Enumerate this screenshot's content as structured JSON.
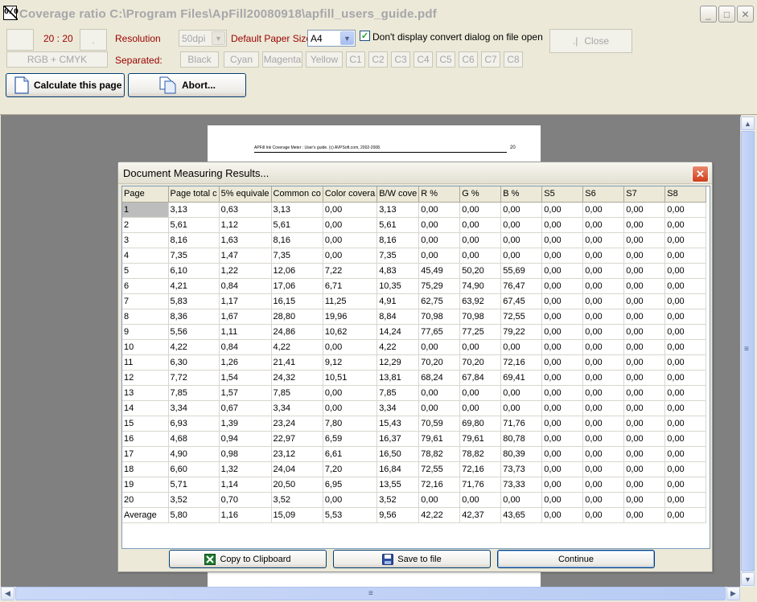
{
  "window": {
    "icon_text": "0/0",
    "title": "Coverage ratio C:\\Program Files\\ApFill20080918\\apfill_users_guide.pdf",
    "controls": {
      "minimize": "_",
      "maximize": "□",
      "close": "✕"
    }
  },
  "toolbar": {
    "blank1": "",
    "page_range": "20 : 20",
    "blank2": ".",
    "resolution_label": "Resolution",
    "resolution_value": "50dpi",
    "paper_size_label": "Default Paper Size",
    "paper_size_value": "A4",
    "dont_display_label": "Don't display convert dialog on file open",
    "dont_display_checked": true,
    "close_label": "Close",
    "rgb_cmyk_label": "RGB + CMYK",
    "separated_label": "Separated:",
    "separations": [
      "Black",
      "Cyan",
      "Magenta",
      "Yellow",
      "C1",
      "C2",
      "C3",
      "C4",
      "C5",
      "C6",
      "C7",
      "C8"
    ],
    "calculate_label": "Calculate this page",
    "abort_label": "Abort..."
  },
  "page_preview": {
    "header_text": "APFill Ink Coverage Meter : User's guide. (c) AVPSoft.com, 2002-2008.",
    "page_number": "20"
  },
  "dialog": {
    "title": "Document Measuring Results...",
    "close": "✕",
    "columns": [
      "Page",
      "Page total c",
      "5% equivale",
      "Common co",
      "Color covera",
      "B/W cove",
      "R %",
      "G %",
      "B %",
      "S5",
      "S6",
      "S7",
      "S8"
    ],
    "rows": [
      [
        "1",
        "3,13",
        "0,63",
        "3,13",
        "0,00",
        "3,13",
        "0,00",
        "0,00",
        "0,00",
        "0,00",
        "0,00",
        "0,00",
        "0,00"
      ],
      [
        "2",
        "5,61",
        "1,12",
        "5,61",
        "0,00",
        "5,61",
        "0,00",
        "0,00",
        "0,00",
        "0,00",
        "0,00",
        "0,00",
        "0,00"
      ],
      [
        "3",
        "8,16",
        "1,63",
        "8,16",
        "0,00",
        "8,16",
        "0,00",
        "0,00",
        "0,00",
        "0,00",
        "0,00",
        "0,00",
        "0,00"
      ],
      [
        "4",
        "7,35",
        "1,47",
        "7,35",
        "0,00",
        "7,35",
        "0,00",
        "0,00",
        "0,00",
        "0,00",
        "0,00",
        "0,00",
        "0,00"
      ],
      [
        "5",
        "6,10",
        "1,22",
        "12,06",
        "7,22",
        "4,83",
        "45,49",
        "50,20",
        "55,69",
        "0,00",
        "0,00",
        "0,00",
        "0,00"
      ],
      [
        "6",
        "4,21",
        "0,84",
        "17,06",
        "6,71",
        "10,35",
        "75,29",
        "74,90",
        "76,47",
        "0,00",
        "0,00",
        "0,00",
        "0,00"
      ],
      [
        "7",
        "5,83",
        "1,17",
        "16,15",
        "11,25",
        "4,91",
        "62,75",
        "63,92",
        "67,45",
        "0,00",
        "0,00",
        "0,00",
        "0,00"
      ],
      [
        "8",
        "8,36",
        "1,67",
        "28,80",
        "19,96",
        "8,84",
        "70,98",
        "70,98",
        "72,55",
        "0,00",
        "0,00",
        "0,00",
        "0,00"
      ],
      [
        "9",
        "5,56",
        "1,11",
        "24,86",
        "10,62",
        "14,24",
        "77,65",
        "77,25",
        "79,22",
        "0,00",
        "0,00",
        "0,00",
        "0,00"
      ],
      [
        "10",
        "4,22",
        "0,84",
        "4,22",
        "0,00",
        "4,22",
        "0,00",
        "0,00",
        "0,00",
        "0,00",
        "0,00",
        "0,00",
        "0,00"
      ],
      [
        "11",
        "6,30",
        "1,26",
        "21,41",
        "9,12",
        "12,29",
        "70,20",
        "70,20",
        "72,16",
        "0,00",
        "0,00",
        "0,00",
        "0,00"
      ],
      [
        "12",
        "7,72",
        "1,54",
        "24,32",
        "10,51",
        "13,81",
        "68,24",
        "67,84",
        "69,41",
        "0,00",
        "0,00",
        "0,00",
        "0,00"
      ],
      [
        "13",
        "7,85",
        "1,57",
        "7,85",
        "0,00",
        "7,85",
        "0,00",
        "0,00",
        "0,00",
        "0,00",
        "0,00",
        "0,00",
        "0,00"
      ],
      [
        "14",
        "3,34",
        "0,67",
        "3,34",
        "0,00",
        "3,34",
        "0,00",
        "0,00",
        "0,00",
        "0,00",
        "0,00",
        "0,00",
        "0,00"
      ],
      [
        "15",
        "6,93",
        "1,39",
        "23,24",
        "7,80",
        "15,43",
        "70,59",
        "69,80",
        "71,76",
        "0,00",
        "0,00",
        "0,00",
        "0,00"
      ],
      [
        "16",
        "4,68",
        "0,94",
        "22,97",
        "6,59",
        "16,37",
        "79,61",
        "79,61",
        "80,78",
        "0,00",
        "0,00",
        "0,00",
        "0,00"
      ],
      [
        "17",
        "4,90",
        "0,98",
        "23,12",
        "6,61",
        "16,50",
        "78,82",
        "78,82",
        "80,39",
        "0,00",
        "0,00",
        "0,00",
        "0,00"
      ],
      [
        "18",
        "6,60",
        "1,32",
        "24,04",
        "7,20",
        "16,84",
        "72,55",
        "72,16",
        "73,73",
        "0,00",
        "0,00",
        "0,00",
        "0,00"
      ],
      [
        "19",
        "5,71",
        "1,14",
        "20,50",
        "6,95",
        "13,55",
        "72,16",
        "71,76",
        "73,33",
        "0,00",
        "0,00",
        "0,00",
        "0,00"
      ],
      [
        "20",
        "3,52",
        "0,70",
        "3,52",
        "0,00",
        "3,52",
        "0,00",
        "0,00",
        "0,00",
        "0,00",
        "0,00",
        "0,00",
        "0,00"
      ],
      [
        "Average",
        "5,80",
        "1,16",
        "15,09",
        "5,53",
        "9,56",
        "42,22",
        "42,37",
        "43,65",
        "0,00",
        "0,00",
        "0,00",
        "0,00"
      ]
    ],
    "copy_label": "Copy to Clipboard",
    "save_label": "Save to file",
    "continue_label": "Continue"
  },
  "scrollbars": {
    "up": "▲",
    "down": "▼",
    "left": "◀",
    "right": "▶",
    "grip": "≡"
  }
}
